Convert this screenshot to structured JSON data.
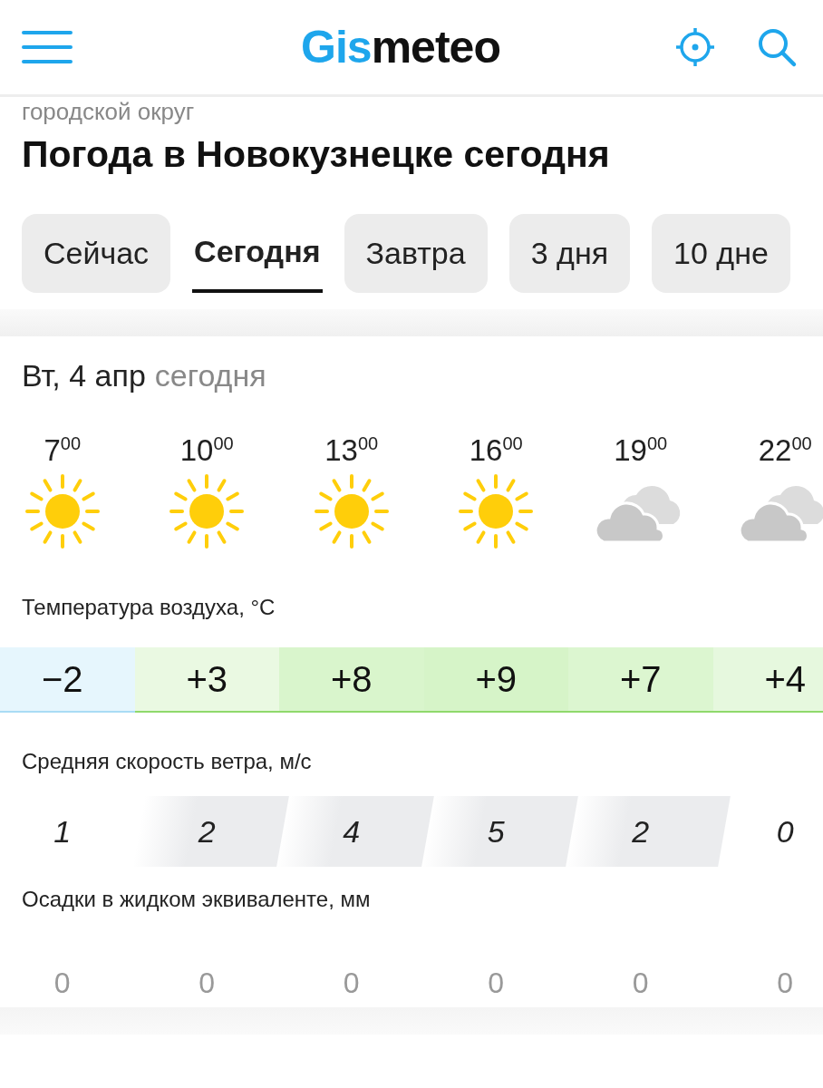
{
  "header": {
    "logo_accent": "Gis",
    "logo_rest": "meteo"
  },
  "breadcrumb": "городской округ",
  "title": "Погода в Новокузнецке сегодня",
  "tabs": [
    {
      "label": "Сейчас",
      "selected": false
    },
    {
      "label": "Сегодня",
      "selected": true
    },
    {
      "label": "Завтра",
      "selected": false
    },
    {
      "label": "3 дня",
      "selected": false
    },
    {
      "label": "10 дне",
      "selected": false
    }
  ],
  "day": {
    "date": "Вт, 4 апр",
    "note": "сегодня"
  },
  "hours": [
    {
      "time": "7$^{00}$",
      "kind": "sunny"
    },
    {
      "time": "10$^{00}$",
      "kind": "sunny"
    },
    {
      "time": "13$^{00}$",
      "kind": "sunny"
    },
    {
      "time": "16$^{00}$",
      "kind": "sunny"
    },
    {
      "time": "19$^{00}$",
      "kind": "cloudy"
    },
    {
      "time": "22$^{00}$",
      "kind": "cloudy"
    }
  ],
  "temperature": {
    "label": "Температура воздуха, °C",
    "values": [
      {
        "value": "−2",
        "color": "#e6f6fd"
      },
      {
        "value": "+3",
        "color": "#eaf9e2"
      },
      {
        "value": "+8",
        "color": "#d9f5cc"
      },
      {
        "value": "+9",
        "color": "#d6f4c8"
      },
      {
        "value": "+7",
        "color": "#dcf6d0"
      },
      {
        "value": "+4",
        "color": "#e6f8de"
      }
    ]
  },
  "wind": {
    "label": "Средняя скорость ветра, м/с",
    "values": [
      {
        "value": "1",
        "highlighted": false
      },
      {
        "value": "2",
        "highlighted": true
      },
      {
        "value": "4",
        "highlighted": true
      },
      {
        "value": "5",
        "highlighted": true
      },
      {
        "value": "2",
        "highlighted": true
      },
      {
        "value": "0",
        "highlighted": false
      }
    ]
  },
  "precipitation": {
    "label": "Осадки в жидком эквиваленте, мм",
    "values": [
      "0",
      "0",
      "0",
      "0",
      "0",
      "0"
    ]
  }
}
